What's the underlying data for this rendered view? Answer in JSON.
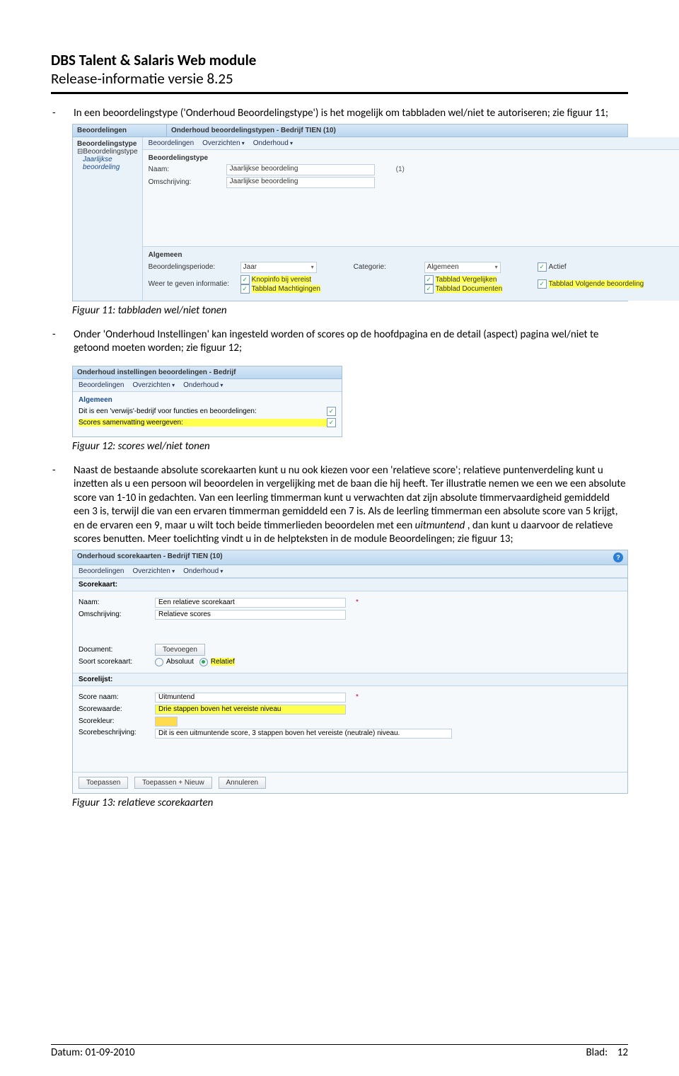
{
  "header": {
    "title": "DBS Talent & Salaris Web module",
    "subtitle": "Release-informatie versie 8.25"
  },
  "bullet1": "In een beoordelingstype ('Onderhoud Beoordelingstype') is het mogelijk om tabbladen wel/niet te autoriseren; zie figuur 11;",
  "caption11": "Figuur 11: tabbladen wel/niet tonen",
  "bullet2": "Onder 'Onderhoud Instellingen' kan ingesteld worden of scores op de hoofdpagina en de detail (aspect) pagina wel/niet te getoond moeten worden; zie figuur 12;",
  "caption12": "Figuur 12: scores wel/niet tonen",
  "bullet3_a": "Naast de bestaande absolute scorekaarten kunt u nu ook kiezen voor een 'relatieve score'; relatieve puntenverdeling kunt u inzetten als u een persoon wil beoordelen in vergelijking met de baan die hij heeft. Ter illustratie nemen we een we een absolute score van 1-10 in gedachten. Van een leerling timmerman kunt u verwachten dat zijn absolute timmervaardigheid gemiddeld een 3 is, terwijl die van een ervaren timmerman gemiddeld een 7 is. Als de leerling timmerman een absolute score van 5 krijgt, en de ervaren een 9, maar u wilt toch beide timmerlieden beoordelen met een ",
  "bullet3_em": "uitmuntend ",
  "bullet3_b": ", dan kunt u daarvoor de relatieve scores benutten. Meer toelichting vindt u in de helpteksten in de module Beoordelingen; zie figuur 13;",
  "caption13": "Figuur 13: relatieve scorekaarten",
  "footer": {
    "date_label": "Datum: 01-09-2010",
    "page_label": "Blad:",
    "page_number": "12"
  },
  "ss1": {
    "leftTitle": "Beoordelingen",
    "mainTitle": "Onderhoud beoordelingstypen - Bedrijf TIEN (10)",
    "sideHead": "Beoordelingstype",
    "sideSub": "⊟Beoordelingstype",
    "sideLink": "Jaarlijkse beoordeling",
    "tabs": [
      "Beoordelingen",
      "Overzichten",
      "Onderhoud"
    ],
    "sectHead": "Beoordelingstype",
    "naamLabel": "Naam:",
    "naamValue": "Jaarlijkse beoordeling",
    "naamAfter": "(1)",
    "omsLabel": "Omschrijving:",
    "omsValue": "Jaarlijkse beoordeling",
    "algHead": "Algemeen",
    "periodLabel": "Beoordelingsperiode:",
    "periodValue": "Jaar",
    "catLabel": "Categorie:",
    "catValue": "Algemeen",
    "chkActief": "Actief",
    "infoLabel": "Weer te geven informatie:",
    "chk1": "Knopinfo bij vereist",
    "chk2": "Tabblad Machtigingen",
    "chk3": "Tabblad Vergelijken",
    "chk4": "Tabblad Documenten",
    "chk5": "Tabblad Volgende beoordeling"
  },
  "ss2": {
    "title": "Onderhoud instellingen beoordelingen - Bedrijf ",
    "tabs": [
      "Beoordelingen",
      "Overzichten",
      "Onderhoud"
    ],
    "algHead": "Algemeen",
    "line1": "Dit is een 'verwijs'-bedrijf voor functies en beoordelingen:",
    "line2": "Scores samenvatting weergeven:"
  },
  "ss3": {
    "title": "Onderhoud scorekaarten - Bedrijf TIEN (10)",
    "tabs": [
      "Beoordelingen",
      "Overzichten",
      "Onderhoud"
    ],
    "sect1": "Scorekaart:",
    "naamLabel": "Naam:",
    "naamValue": "Een relatieve scorekaart",
    "omsLabel": "Omschrijving:",
    "omsValue": "Relatieve scores",
    "docLabel": "Document:",
    "btnToevoegen": "Toevoegen",
    "soortLabel": "Soort scorekaart:",
    "soortOpt1": "Absoluut",
    "soortOpt2": "Relatief",
    "sect2": "Scorelijst:",
    "scoreNaamLabel": "Score naam:",
    "scoreNaamValue": "Uitmuntend",
    "scoreWaardeLabel": "Scorewaarde:",
    "scoreWaardeValue": "Drie stappen boven het vereiste niveau",
    "scoreKleurLabel": "Scorekleur:",
    "scoreBeschLabel": "Scorebeschrijving:",
    "scoreBeschValue": "Dit is een uitmuntende score, 3 stappen boven het vereiste (neutrale) niveau.",
    "btn1": "Toepassen",
    "btn2": "Toepassen + Nieuw",
    "btn3": "Annuleren"
  }
}
